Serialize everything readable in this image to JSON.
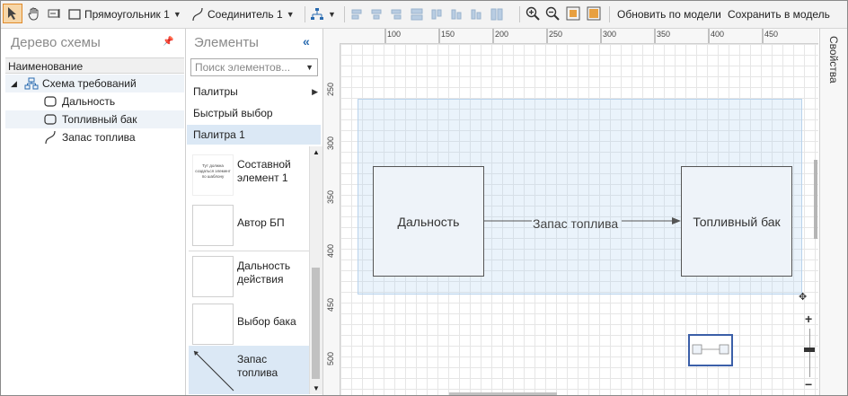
{
  "toolbar": {
    "shape_label": "Прямоугольник 1",
    "connector_label": "Соединитель 1",
    "update_model": "Обновить по модели",
    "save_model": "Сохранить в модель"
  },
  "tree_panel": {
    "title": "Дерево схемы",
    "column_header": "Наименование",
    "root": "Схема требований",
    "items": [
      "Дальность",
      "Топливный бак",
      "Запас топлива"
    ]
  },
  "elements_panel": {
    "title": "Элементы",
    "search_placeholder": "Поиск элементов...",
    "menu": [
      "Палитры",
      "Быстрый выбор",
      "Палитра 1"
    ],
    "palette_items": [
      {
        "label": "Составной элемент 1",
        "thumb_text": "Тут должна создаться элемент по шаблону"
      },
      {
        "label": "Автор БП"
      },
      {
        "label": "Дальность действия"
      },
      {
        "label": "Выбор бака"
      },
      {
        "label": "Запас топлива"
      }
    ]
  },
  "canvas": {
    "ruler_top": [
      "100",
      "150",
      "200",
      "250",
      "300",
      "350",
      "400",
      "450"
    ],
    "ruler_left": [
      "250",
      "300",
      "350",
      "400",
      "450",
      "500"
    ],
    "node_left": "Дальность",
    "node_right": "Топливный бак",
    "connector_label": "Запас топлива"
  },
  "properties": {
    "label": "Свойства"
  },
  "colors": {
    "accent": "#2a6bb0",
    "node_fill": "#eef3f9",
    "selection": "#adc0f0"
  }
}
